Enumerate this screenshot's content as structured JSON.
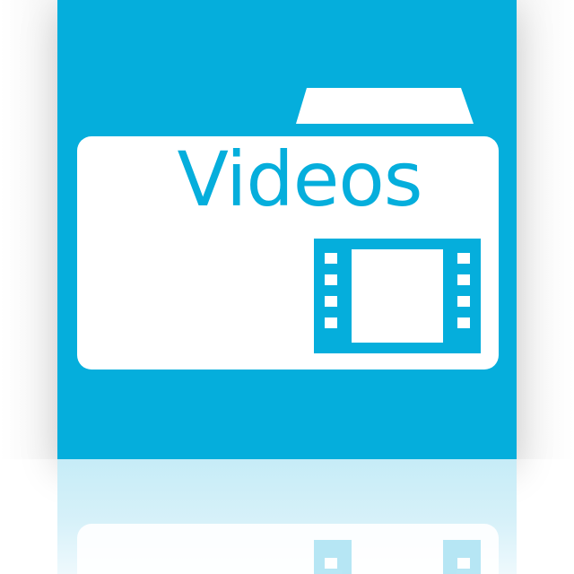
{
  "folder": {
    "label": "Videos",
    "icon": "film-icon"
  },
  "colors": {
    "tile_background": "#05aedc",
    "folder_body": "#ffffff",
    "label_text": "#05aedc",
    "reflection": "#c6ecf7"
  }
}
